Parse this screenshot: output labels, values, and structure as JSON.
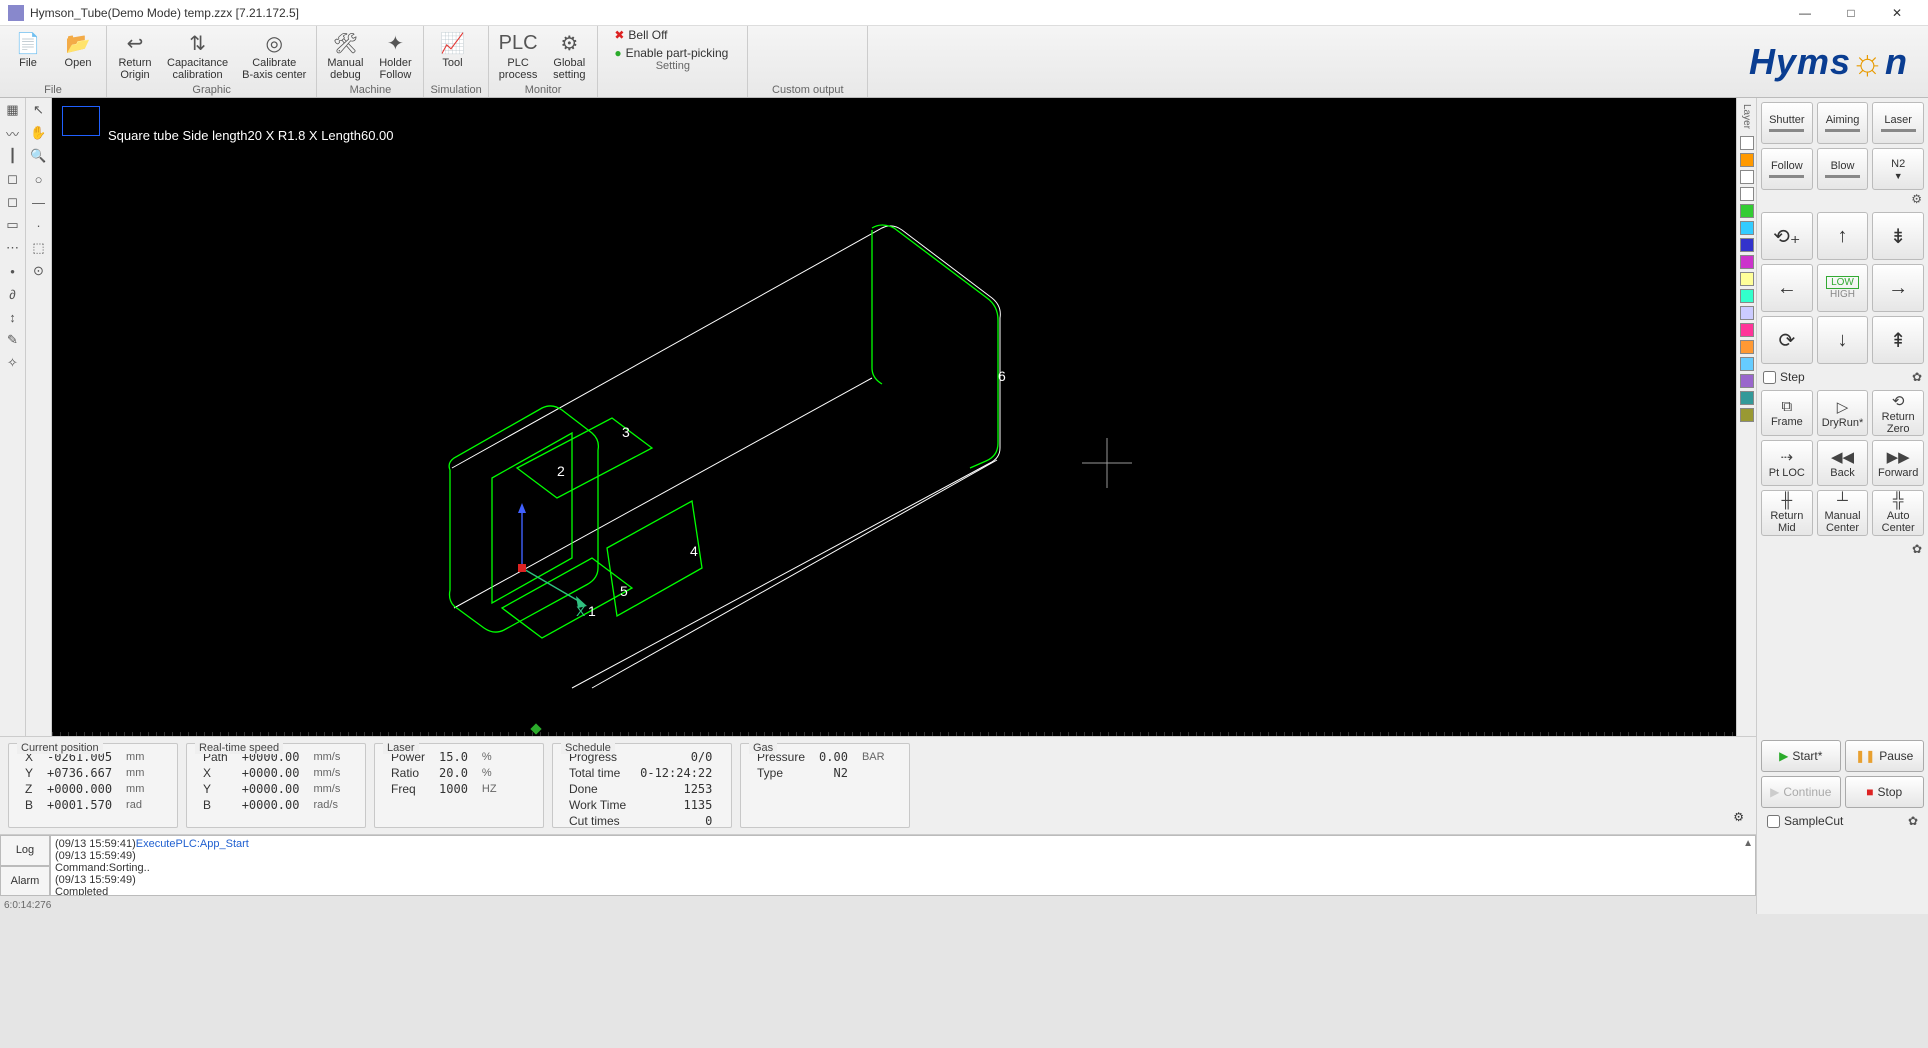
{
  "title": "Hymson_Tube(Demo Mode) temp.zzx  [7.21.172.5]",
  "ribbon": {
    "groups": [
      {
        "label": "File",
        "items": [
          {
            "name": "file-btn",
            "icon": "📄",
            "label": "File"
          },
          {
            "name": "open-btn",
            "icon": "📂",
            "label": "Open"
          }
        ]
      },
      {
        "label": "Graphic",
        "items": [
          {
            "name": "return-origin-btn",
            "icon": "↩",
            "label": "Return\nOrigin"
          },
          {
            "name": "cap-cal-btn",
            "icon": "⇅",
            "label": "Capacitance\ncalibration"
          },
          {
            "name": "calib-b-btn",
            "icon": "◎",
            "label": "Calibrate\nB-axis center"
          }
        ]
      },
      {
        "label": "Machine",
        "items": [
          {
            "name": "manual-debug-btn",
            "icon": "🛠",
            "label": "Manual\ndebug"
          },
          {
            "name": "holder-follow-btn",
            "icon": "✦",
            "label": "Holder\nFollow"
          }
        ]
      },
      {
        "label": "Simulation",
        "items": [
          {
            "name": "tool-btn",
            "icon": "📈",
            "label": "Tool"
          }
        ]
      },
      {
        "label": "Monitor",
        "items": [
          {
            "name": "plc-process-btn",
            "icon": "PLC",
            "label": "PLC\nprocess"
          },
          {
            "name": "global-setting-btn",
            "icon": "⚙",
            "label": "Global\nsetting"
          }
        ]
      }
    ],
    "settings": {
      "bell": "Bell Off",
      "partpick": "Enable part-picking",
      "label": "Setting"
    },
    "custom": {
      "label": "Custom output"
    }
  },
  "brand": {
    "left": "Hy",
    "mid": "ms",
    "o": "☼",
    "right": "n"
  },
  "canvas": {
    "caption": "Square tube Side length20 X R1.8 X Length60.00",
    "labels": {
      "1": "1",
      "2": "2",
      "3": "3",
      "4": "4",
      "5": "5",
      "6": "6",
      "x": "X"
    }
  },
  "left_tools1": [
    "▦",
    "〰",
    "┃",
    "◻",
    "◻",
    "▭",
    "⋯",
    "•",
    "∂",
    "↕",
    "✎",
    "✧"
  ],
  "left_tools2": [
    "↖",
    "✋",
    "🔍",
    "○",
    "—",
    "·",
    "⬚",
    "⊙"
  ],
  "layers": {
    "label": "Layer",
    "colors": [
      "#ffffff",
      "#ff9900",
      "#ffffff",
      "#ffffff",
      "#33cc33",
      "#33ccff",
      "#3333cc",
      "#cc33cc",
      "#ffff99",
      "#33ffcc",
      "#ccccff",
      "#ff3399",
      "#ff9933",
      "#66ccff",
      "#9966cc",
      "#339999",
      "#999933"
    ]
  },
  "right": {
    "row1": [
      {
        "name": "shutter-btn",
        "label": "Shutter"
      },
      {
        "name": "aiming-btn",
        "label": "Aiming"
      },
      {
        "name": "laser-btn",
        "label": "Laser"
      }
    ],
    "row2": [
      {
        "name": "follow-btn",
        "label": "Follow"
      },
      {
        "name": "blow-btn",
        "label": "Blow"
      },
      {
        "name": "n2-btn",
        "label": "N2",
        "drop": true
      }
    ],
    "gear1": "⚙",
    "jog": {
      "tl": "⟲₊",
      "up": "↑",
      "tr": "⇟",
      "l": "←",
      "mid": {
        "top": "LOW",
        "bot": "HIGH"
      },
      "r": "→",
      "bl": "⟳",
      "dn": "↓",
      "br": "⇞"
    },
    "step": {
      "label": "Step",
      "gear": "✿"
    },
    "acts": [
      [
        {
          "n": "frame-btn",
          "ic": "⧉",
          "l": "Frame"
        },
        {
          "n": "dryrun-btn",
          "ic": "▷",
          "l": "DryRun*"
        },
        {
          "n": "returnzero-btn",
          "ic": "⟲",
          "l": "Return\nZero"
        }
      ],
      [
        {
          "n": "ptloc-btn",
          "ic": "⇢",
          "l": "Pt LOC"
        },
        {
          "n": "back-btn",
          "ic": "◀◀",
          "l": "Back"
        },
        {
          "n": "forward-btn",
          "ic": "▶▶",
          "l": "Forward"
        }
      ],
      [
        {
          "n": "returnmid-btn",
          "ic": "╫",
          "l": "Return\nMid"
        },
        {
          "n": "manualcenter-btn",
          "ic": "┴",
          "l": "Manual\nCenter"
        },
        {
          "n": "autocenter-btn",
          "ic": "╬",
          "l": "Auto\nCenter"
        }
      ]
    ],
    "gear2": "✿"
  },
  "status": {
    "pos": {
      "title": "Current position",
      "rows": [
        [
          "X",
          "-0261.005",
          "mm"
        ],
        [
          "Y",
          "+0736.667",
          "mm"
        ],
        [
          "Z",
          "+0000.000",
          "mm"
        ],
        [
          "B",
          "+0001.570",
          "rad"
        ]
      ]
    },
    "speed": {
      "title": "Real-time speed",
      "rows": [
        [
          "Path",
          "+0000.00",
          "mm/s"
        ],
        [
          "X",
          "+0000.00",
          "mm/s"
        ],
        [
          "Y",
          "+0000.00",
          "mm/s"
        ],
        [
          "B",
          "+0000.00",
          "rad/s"
        ]
      ]
    },
    "laser": {
      "title": "Laser",
      "rows": [
        [
          "Power",
          "15.0",
          "%"
        ],
        [
          "Ratio",
          "20.0",
          "%"
        ],
        [
          "Freq",
          "1000",
          "HZ"
        ]
      ]
    },
    "sched": {
      "title": "Schedule",
      "rows": [
        [
          "Progress",
          "0/0",
          ""
        ],
        [
          "Total time",
          "0-12:24:22",
          ""
        ],
        [
          "Done",
          "1253",
          ""
        ],
        [
          "Work Time",
          "1135",
          ""
        ],
        [
          "Cut times",
          "0",
          ""
        ]
      ]
    },
    "gas": {
      "title": "Gas",
      "rows": [
        [
          "Pressure",
          "0.00",
          "BAR"
        ],
        [
          "Type",
          "N2",
          ""
        ]
      ]
    },
    "gear": "⚙"
  },
  "log": {
    "tabs": [
      "Log",
      "Alarm"
    ],
    "lines": [
      "(09/13 15:59:41)ExecutePLC:App_Start",
      "(09/13 15:59:49)",
      "Command:Sorting..",
      "(09/13 15:59:49)",
      "Completed"
    ]
  },
  "run": {
    "start": "Start*",
    "pause": "Pause",
    "continue": "Continue",
    "stop": "Stop",
    "samplecut": "SampleCut",
    "gear": "✿"
  },
  "floor": "6:0:14:276"
}
